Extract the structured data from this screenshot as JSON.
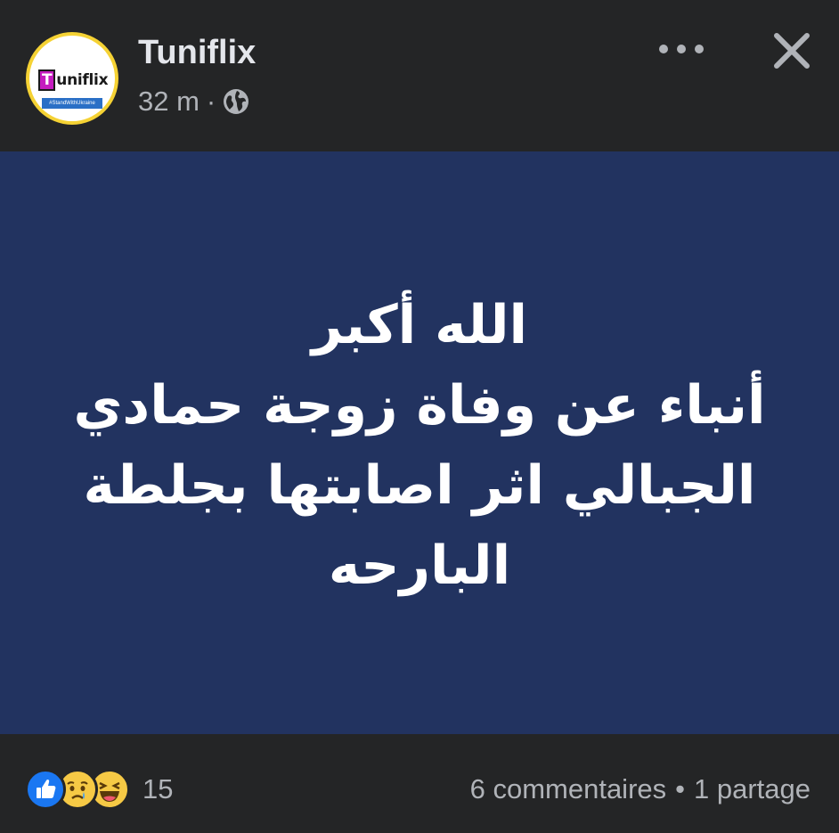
{
  "header": {
    "page_name": "Tuniflix",
    "time": "32 m",
    "separator": "·",
    "avatar": {
      "logo_letter": "T",
      "logo_rest": "uniflix",
      "tag": "#StandWithUkraine"
    },
    "privacy_icon": "globe-icon",
    "more_icon": "more-horizontal-icon",
    "close_icon": "close-icon"
  },
  "post": {
    "background_color": "#223360",
    "lines": [
      "الله أكبر",
      "أنباء عن وفاة زوجة حمادي",
      "الجبالي اثر اصابتها بجلطة",
      "البارحه"
    ]
  },
  "footer": {
    "reactions": [
      "like-icon",
      "sad-icon",
      "haha-icon"
    ],
    "reaction_count": "15",
    "comments": "6 commentaires",
    "separator": "•",
    "shares": "1 partage"
  },
  "colors": {
    "background": "#242526",
    "primary_text": "#e4e6eb",
    "secondary_text": "#b0b3b8",
    "like_blue": "#1a77f2",
    "emoji_yellow": "#f6c945"
  }
}
